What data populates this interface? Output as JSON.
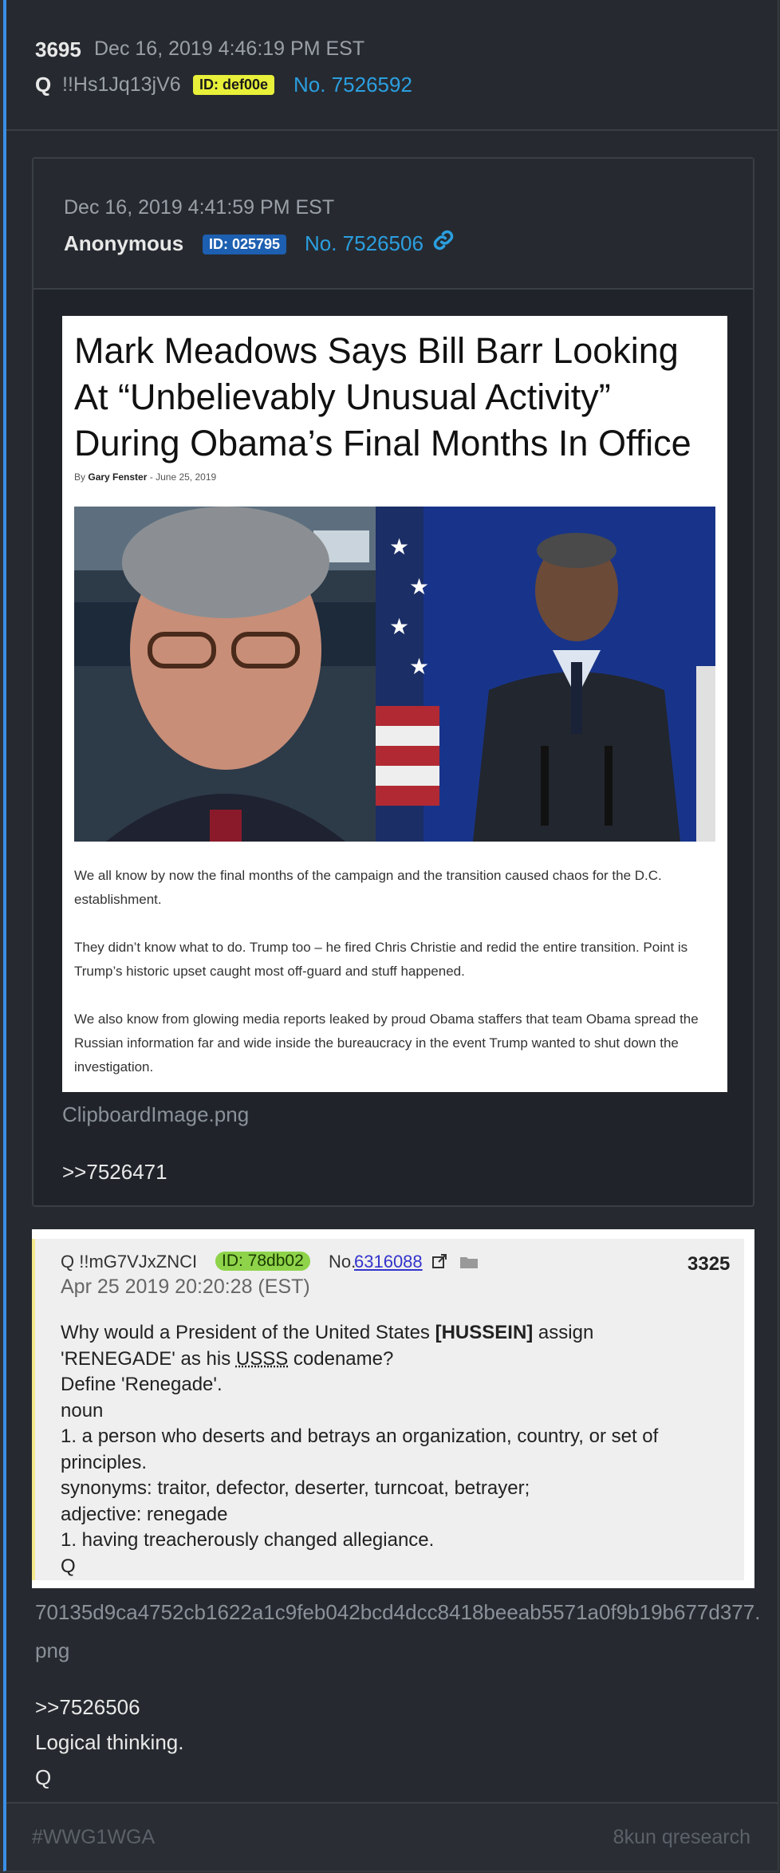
{
  "post": {
    "number": "3695",
    "date": "Dec 16, 2019 4:46:19 PM EST",
    "author": "Q",
    "tripcode": "!!Hs1Jq13jV6",
    "id_badge": "ID: def00e",
    "post_no": "No. 7526592",
    "message_lines": [
      ">>7526506",
      "Logical thinking.",
      "Q"
    ]
  },
  "quoted": {
    "date": "Dec 16, 2019 4:41:59 PM EST",
    "author": "Anonymous",
    "id_badge": "ID: 025795",
    "post_no": "No. 7526506",
    "attachment_name": "ClipboardImage.png",
    "reply_ref": ">>7526471"
  },
  "article": {
    "title": "Mark Meadows Says Bill Barr Looking At “Unbelievably Unusual Activity” During Obama’s Final Months In Office",
    "by_label": "By",
    "author": "Gary Fenster",
    "separator": "-",
    "date": "June 25, 2019",
    "paragraphs": [
      "We all know by now the final months of the campaign and the transition caused chaos for the D.C. establishment.",
      "They didn’t know what to do. Trump too – he fired Chris Christie and redid the entire transition. Point is Trump’s historic upset caught most off-guard and stuff happened.",
      "We also know from glowing media reports leaked by proud Obama staffers that team Obama spread the Russian information far and wide inside the bureaucracy in the event Trump wanted to shut down the investigation."
    ]
  },
  "q_capture": {
    "name": "Q !!mG7VJxZNCI",
    "id_badge": "ID: 78db02",
    "no_label": "No.",
    "no_link": "6316088",
    "count": "3325",
    "date": "Apr 25 2019 20:20:28 (EST)",
    "line1_pre": "Why would a President of the United States ",
    "line1_bold": "[HUSSEIN]",
    "line1_post": " assign",
    "line2_pre": "'RENEGADE' as his ",
    "line2_ul": "USSS",
    "line2_post": " codename?",
    "rest": "Define 'Renegade'.\nnoun\n1. a person who deserts and betrays an organization, country, or set of principles.\nsynonyms: traitor, defector, deserter, turncoat, betrayer;\nadjective: renegade\n1. having treacherously changed allegiance.\nQ",
    "attachment_name": "70135d9ca4752cb1622a1c9feb042bcd4dcc8418beeab5571a0f9b19b677d377.png"
  },
  "footer": {
    "hashtag": "#WWG1WGA",
    "source": "8kun qresearch"
  },
  "colors": {
    "accent": "#3b8fe6",
    "link": "#2b9fe0",
    "id_yellow": "#e8f03a",
    "id_blue": "#1d5fb0",
    "id_green": "#8ed34a"
  },
  "icons": [
    "link-chain-icon",
    "external-link-icon",
    "folder-icon"
  ]
}
